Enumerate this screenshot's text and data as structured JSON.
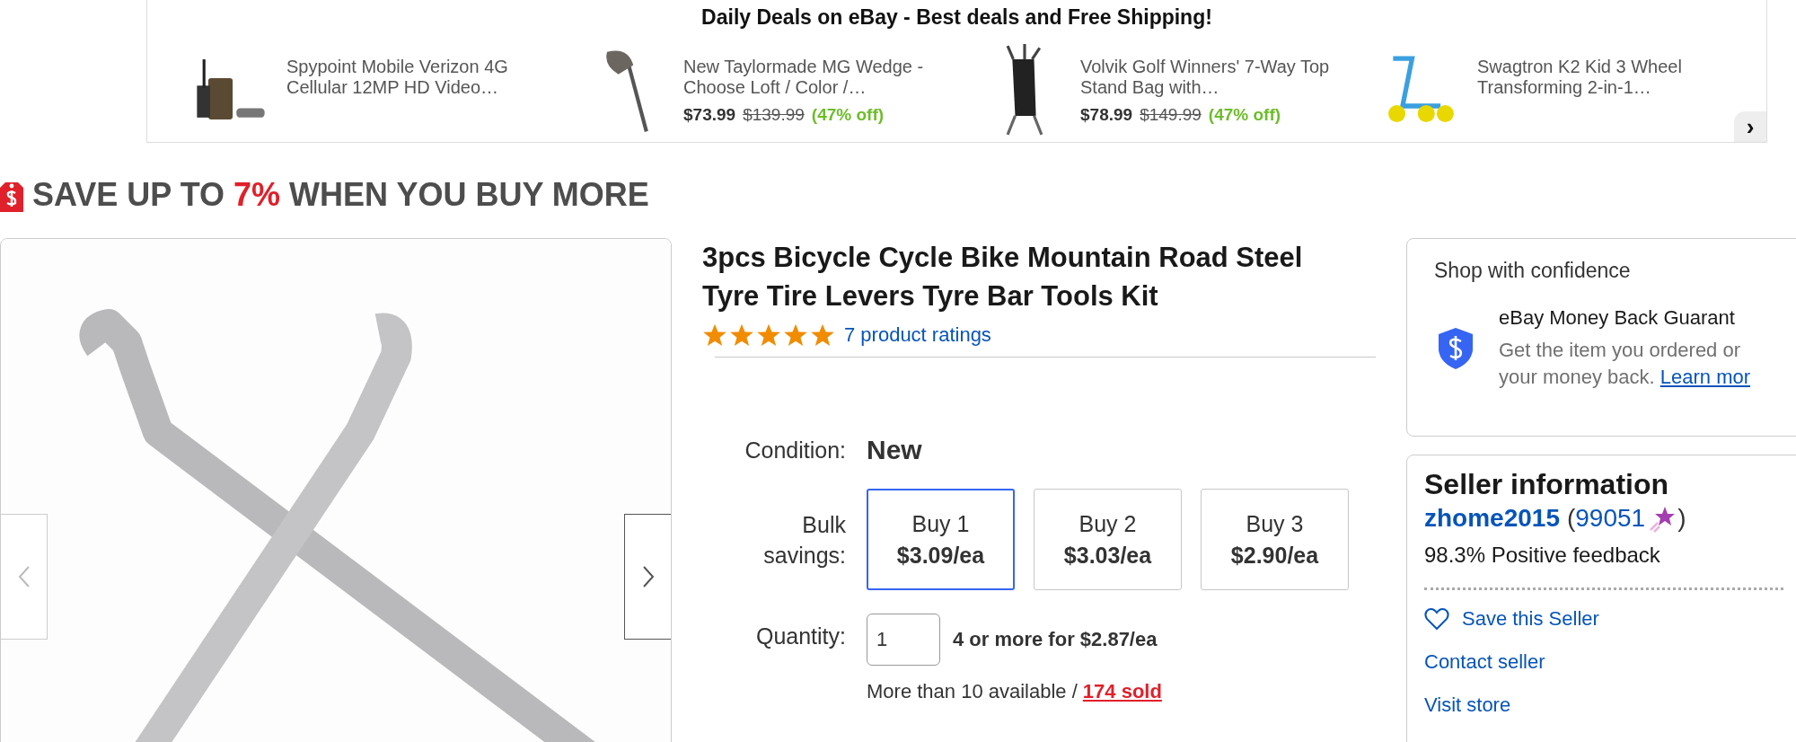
{
  "deals_banner": {
    "title": "Daily Deals on eBay - Best deals and Free Shipping!",
    "items": [
      {
        "title": "Spypoint Mobile Verizon 4G Cellular 12MP HD Video…"
      },
      {
        "title": "New Taylormade MG Wedge - Choose Loft / Color /…",
        "price": "$73.99",
        "original_price": "$139.99",
        "discount": "(47% off)"
      },
      {
        "title": "Volvik Golf Winners' 7-Way Top Stand Bag with…",
        "price": "$78.99",
        "original_price": "$149.99",
        "discount": "(47% off)"
      },
      {
        "title": "Swagtron K2 Kid 3 Wheel Transforming 2-in-1…"
      }
    ],
    "next": "›"
  },
  "promo": {
    "prefix": "SAVE UP TO",
    "highlight": "7%",
    "suffix": "WHEN YOU BUY MORE"
  },
  "product": {
    "title": "3pcs Bicycle Cycle Bike Mountain Road Steel Tyre Tire Levers Tyre Bar Tools Kit",
    "stars": 5,
    "ratings_link": "7 product ratings",
    "condition_label": "Condition:",
    "condition": "New",
    "bulk_label": "Bulk savings:",
    "bulk_options": [
      {
        "label": "Buy 1",
        "price": "$3.09/ea",
        "selected": true
      },
      {
        "label": "Buy 2",
        "price": "$3.03/ea",
        "selected": false
      },
      {
        "label": "Buy 3",
        "price": "$2.90/ea",
        "selected": false
      }
    ],
    "quantity_label": "Quantity:",
    "quantity": "1",
    "quantity_offer": "4 or more for $2.87/ea",
    "availability": "More than 10 available /",
    "sold": "174 sold"
  },
  "confidence": {
    "title": "Shop with confidence",
    "guarantee_title": "eBay Money Back Guarant",
    "guarantee_lines": [
      "Get the item you ordered or",
      "your money back."
    ],
    "learn_more": "Learn mor"
  },
  "seller": {
    "title": "Seller information",
    "name": "zhome2015",
    "paren_open": "(",
    "feedback_score": "99051",
    "paren_close": ")",
    "positive": "98.3% Positive feedback",
    "links": [
      {
        "label": "Save this Seller",
        "kind": "save"
      },
      {
        "label": "Contact seller",
        "kind": "plain"
      },
      {
        "label": "Visit store",
        "kind": "plain"
      }
    ]
  }
}
